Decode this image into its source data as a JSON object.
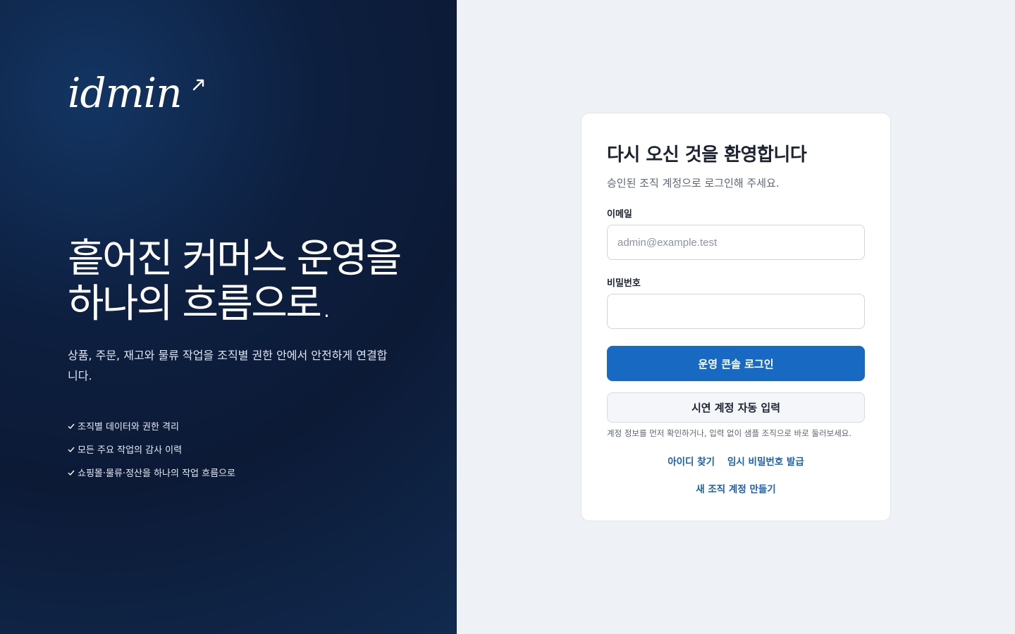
{
  "brand": {
    "logo_text": "idmin"
  },
  "hero": {
    "headline": "흩어진 커머스 운영을 하나의 흐름으로.",
    "description": "상품, 주문, 재고와 물류 작업을 조직별 권한 안에서 안전하게 연결합니다.",
    "features": [
      "조직별 데이터와 권한 격리",
      "모든 주요 작업의 감사 이력",
      "쇼핑몰·물류·정산을 하나의 작업 흐름으로"
    ]
  },
  "login": {
    "title": "다시 오신 것을 환영합니다",
    "subtitle": "승인된 조직 계정으로 로그인해 주세요.",
    "email_label": "이메일",
    "email_placeholder": "admin@example.test",
    "email_value": "",
    "password_label": "비밀번호",
    "password_value": "",
    "submit_label": "운영 콘솔 로그인",
    "demo_label": "시연 계정 자동 입력",
    "help_text": "계정 정보를 먼저 확인하거나, 입력 없이 샘플 조직으로 바로 둘러보세요.",
    "find_id_label": "아이디 찾기",
    "temp_password_label": "임시 비밀번호 발급",
    "create_account_label": "새 조직 계정 만들기"
  },
  "colors": {
    "panel_bg": "#0d1f3f",
    "page_bg": "#eef1f5",
    "accent": "#1769c1",
    "link": "#1b5fb0"
  },
  "icons": {
    "feature_marker": "check-icon",
    "logo_mark": "arrow-up-right-icon"
  }
}
